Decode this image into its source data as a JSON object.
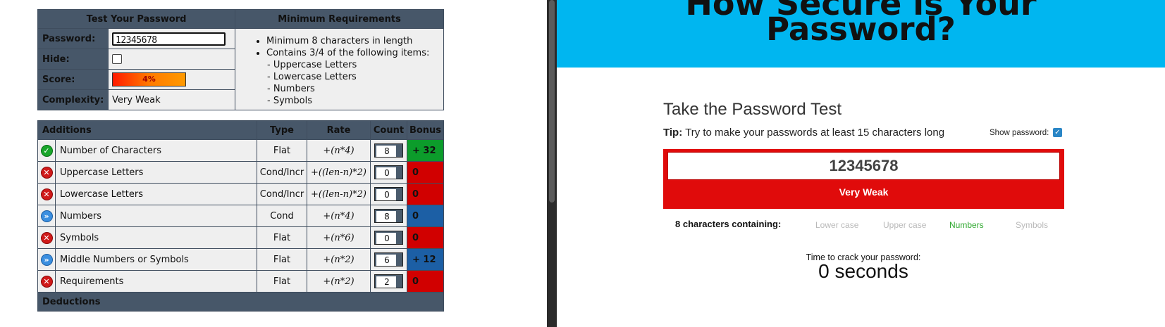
{
  "left": {
    "test_header": "Test Your Password",
    "req_header": "Minimum Requirements",
    "password_label": "Password:",
    "password_value": "12345678",
    "hide_label": "Hide:",
    "score_label": "Score:",
    "score_value": "4%",
    "complexity_label": "Complexity:",
    "complexity_value": "Very Weak",
    "requirements": [
      "Minimum 8 characters in length",
      "Contains 3/4 of the following items:"
    ],
    "req_sub": [
      "- Uppercase Letters",
      "- Lowercase Letters",
      "- Numbers",
      "- Symbols"
    ],
    "additions": {
      "headers": [
        "Additions",
        "Type",
        "Rate",
        "Count",
        "Bonus"
      ],
      "rows": [
        {
          "status": "ok",
          "name": "Number of Characters",
          "type": "Flat",
          "rate": "+(n*4)",
          "count": "8",
          "bonus": "+ 32",
          "color": "green"
        },
        {
          "status": "x",
          "name": "Uppercase Letters",
          "type": "Cond/Incr",
          "rate": "+((len-n)*2)",
          "count": "0",
          "bonus": "0",
          "color": "red"
        },
        {
          "status": "x",
          "name": "Lowercase Letters",
          "type": "Cond/Incr",
          "rate": "+((len-n)*2)",
          "count": "0",
          "bonus": "0",
          "color": "red"
        },
        {
          "status": "n",
          "name": "Numbers",
          "type": "Cond",
          "rate": "+(n*4)",
          "count": "8",
          "bonus": "0",
          "color": "blue"
        },
        {
          "status": "x",
          "name": "Symbols",
          "type": "Flat",
          "rate": "+(n*6)",
          "count": "0",
          "bonus": "0",
          "color": "red"
        },
        {
          "status": "n",
          "name": "Middle Numbers or Symbols",
          "type": "Flat",
          "rate": "+(n*2)",
          "count": "6",
          "bonus": "+ 12",
          "color": "blue"
        },
        {
          "status": "x",
          "name": "Requirements",
          "type": "Flat",
          "rate": "+(n*2)",
          "count": "2",
          "bonus": "0",
          "color": "red"
        }
      ]
    },
    "deductions_header": "Deductions"
  },
  "right": {
    "banner_line1": "How Secure is Your",
    "banner_line2": "Password?",
    "test_title": "Take the Password Test",
    "tip_label": "Tip:",
    "tip_text": " Try to make your passwords at least 15 characters long",
    "show_password_label": "Show password:",
    "password_value": "12345678",
    "strength": "Very Weak",
    "containing": "8 characters containing:",
    "char_types": [
      {
        "label": "Lower case",
        "active": false
      },
      {
        "label": "Upper case",
        "active": false
      },
      {
        "label": "Numbers",
        "active": true
      },
      {
        "label": "Symbols",
        "active": false
      }
    ],
    "crack_label": "Time to crack your password:",
    "crack_value": "0 seconds"
  },
  "colors": {
    "header_bg": "#475769",
    "banner_bg": "#00b6f0",
    "strength_bg": "#e00b0b",
    "bonus_green": "#0c9c2b",
    "bonus_red": "#d10000",
    "bonus_blue": "#1c5fa5"
  }
}
